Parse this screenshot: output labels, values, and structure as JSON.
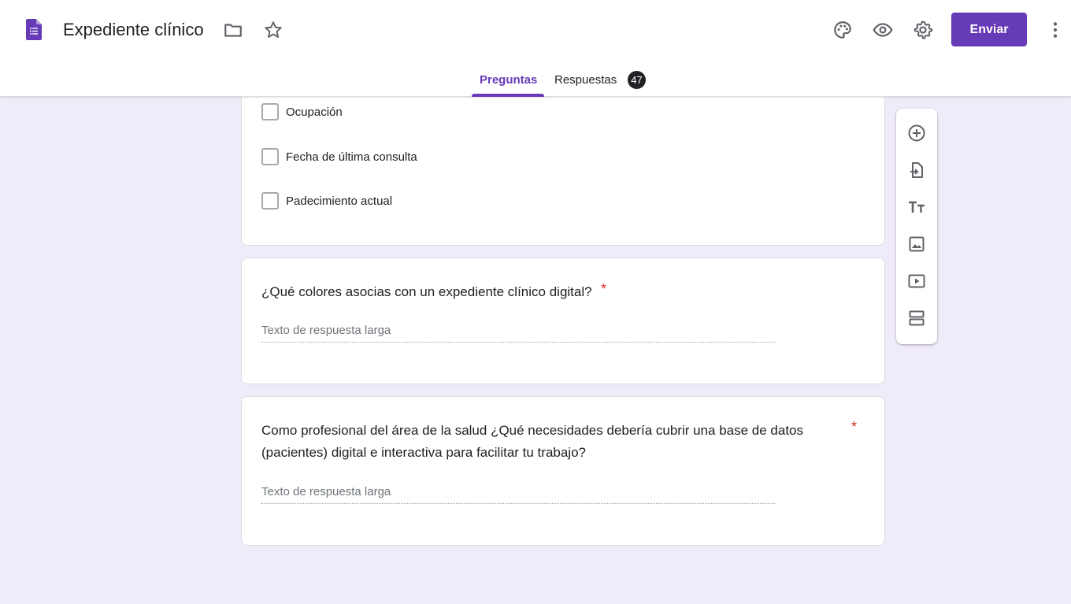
{
  "header": {
    "app_icon": "google-forms-icon",
    "title": "Expediente clínico",
    "icons": [
      "folder-icon",
      "star-icon",
      "palette-icon",
      "eye-icon",
      "gear-icon",
      "more-vert-icon"
    ],
    "send_label": "Enviar"
  },
  "tabs": {
    "questions_label": "Preguntas",
    "responses_label": "Respuestas",
    "responses_count": "47"
  },
  "card1": {
    "options": [
      {
        "label": "Ocupación"
      },
      {
        "label": "Fecha de última consulta"
      },
      {
        "label": "Padecimiento actual"
      }
    ]
  },
  "card2": {
    "question": "¿Qué colores asocias con un expediente clínico digital?",
    "required_mark": "*",
    "placeholder": "Texto de respuesta larga"
  },
  "card3": {
    "question_line1": "Como profesional del área de la salud ¿Qué necesidades debería cubrir una base de datos",
    "question_line2": "(pacientes) digital e interactiva para facilitar tu trabajo?",
    "required_mark": "*",
    "placeholder": "Texto de respuesta larga"
  },
  "toolbar": {
    "tools": [
      "add-question-icon",
      "import-questions-icon",
      "add-title-icon",
      "add-image-icon",
      "add-video-icon",
      "add-section-icon"
    ]
  },
  "colors": {
    "accent": "#673ab7",
    "background": "#f0ebf8",
    "required": "#d93025"
  }
}
